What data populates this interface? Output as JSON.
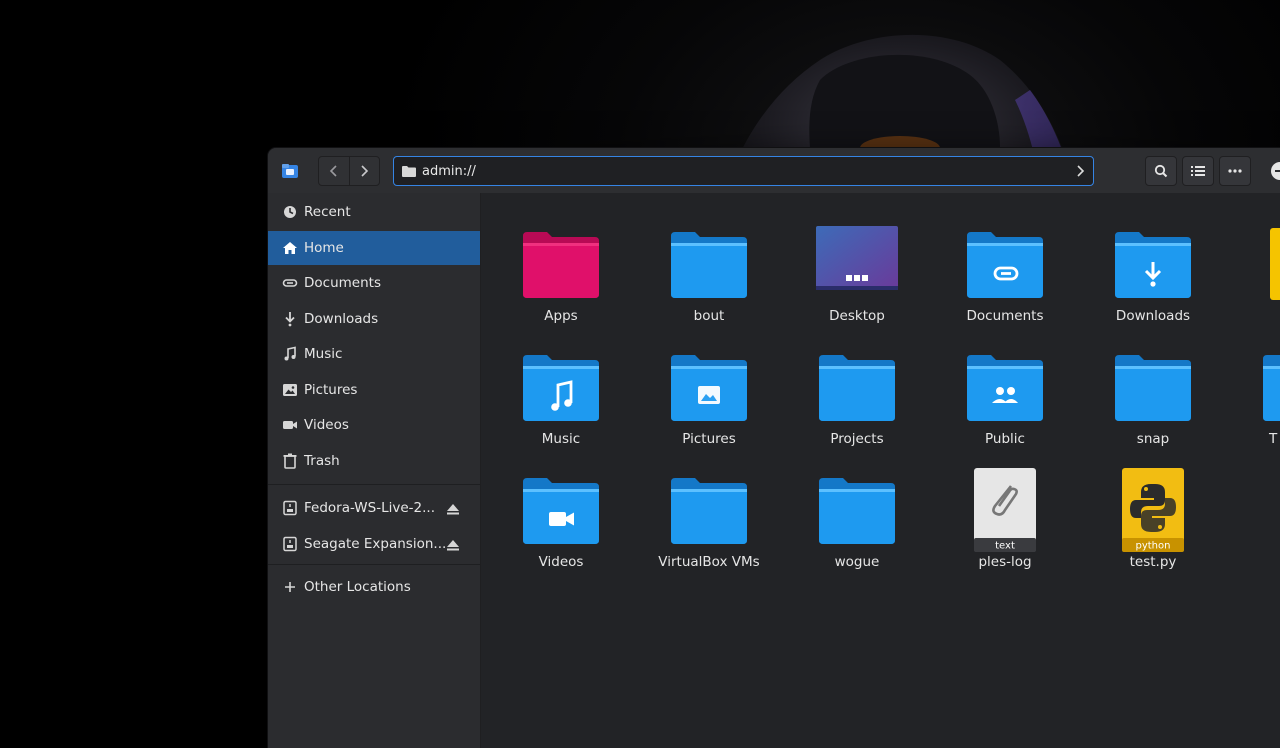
{
  "window": {
    "path": "admin://"
  },
  "sidebar": {
    "places": [
      {
        "label": "Recent",
        "icon": "clock-icon",
        "active": false
      },
      {
        "label": "Home",
        "icon": "home-icon",
        "active": true
      },
      {
        "label": "Documents",
        "icon": "paperclip-icon",
        "active": false
      },
      {
        "label": "Downloads",
        "icon": "download-icon",
        "active": false
      },
      {
        "label": "Music",
        "icon": "music-icon",
        "active": false
      },
      {
        "label": "Pictures",
        "icon": "image-icon",
        "active": false
      },
      {
        "label": "Videos",
        "icon": "video-icon",
        "active": false
      },
      {
        "label": "Trash",
        "icon": "trash-icon",
        "active": false
      }
    ],
    "devices": [
      {
        "label": "Fedora-WS-Live-2...",
        "icon": "drive-icon"
      },
      {
        "label": "Seagate Expansion...",
        "icon": "drive-icon"
      }
    ],
    "other": {
      "label": "Other Locations",
      "icon": "plus-icon"
    }
  },
  "files": [
    {
      "label": "Apps",
      "kind": "folder",
      "color": "#e0106a"
    },
    {
      "label": "bout",
      "kind": "folder",
      "color": "#1e9af0"
    },
    {
      "label": "Desktop",
      "kind": "desktop",
      "color": "#5a5fb0"
    },
    {
      "label": "Documents",
      "kind": "folder",
      "emblem": "paperclip",
      "color": "#1e9af0"
    },
    {
      "label": "Downloads",
      "kind": "folder",
      "emblem": "download",
      "color": "#1e9af0"
    },
    {
      "label": "Music",
      "kind": "folder",
      "emblem": "music",
      "color": "#1e9af0"
    },
    {
      "label": "Pictures",
      "kind": "folder",
      "emblem": "image",
      "color": "#1e9af0"
    },
    {
      "label": "Projects",
      "kind": "folder",
      "color": "#1e9af0"
    },
    {
      "label": "Public",
      "kind": "folder",
      "emblem": "people",
      "color": "#1e9af0"
    },
    {
      "label": "snap",
      "kind": "folder",
      "color": "#1e9af0"
    },
    {
      "label": "Videos",
      "kind": "folder",
      "emblem": "video",
      "color": "#1e9af0"
    },
    {
      "label": "VirtualBox VMs",
      "kind": "folder",
      "color": "#1e9af0"
    },
    {
      "label": "wogue",
      "kind": "folder",
      "color": "#1e9af0"
    },
    {
      "label": "ples-log",
      "kind": "text",
      "badge": "text",
      "color": "#e8e8e8"
    },
    {
      "label": "test.py",
      "kind": "python",
      "badge": "python",
      "color": "#f0b400"
    }
  ],
  "partial": [
    {
      "label": "",
      "color": "#f5c400"
    },
    {
      "label": "T",
      "color": "#1e9af0"
    },
    {
      "label": "",
      "color": ""
    }
  ]
}
